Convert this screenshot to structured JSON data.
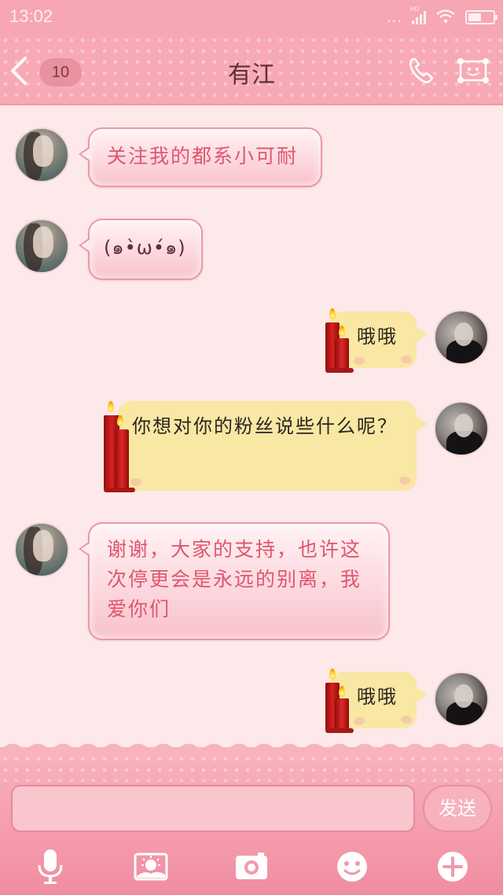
{
  "status_bar": {
    "time": "13:02",
    "dots": "...",
    "hd": "HD"
  },
  "header": {
    "unread_count": "10",
    "title": "有江"
  },
  "messages": [
    {
      "side": "left",
      "text": "关注我的都系小可耐"
    },
    {
      "side": "left",
      "text": "(๑•̀ω•́๑)"
    },
    {
      "side": "right",
      "text": "哦哦"
    },
    {
      "side": "right",
      "text": "你想对你的粉丝说些什么呢？"
    },
    {
      "side": "left",
      "text": "谢谢，大家的支持，也许这次停更会是永远的别离，我爱你们"
    },
    {
      "side": "right",
      "text": "哦哦"
    }
  ],
  "input": {
    "value": "",
    "placeholder": ""
  },
  "send_label": "发送",
  "toolbar": {
    "icons": [
      "microphone-icon",
      "image-icon",
      "camera-icon",
      "emoji-icon",
      "plus-icon"
    ]
  },
  "colors": {
    "header": "#f8a9b6",
    "chat_bg": "#fde9ea",
    "left_bubble_text": "#e0566c",
    "right_bubble": "#f9e7a4"
  }
}
